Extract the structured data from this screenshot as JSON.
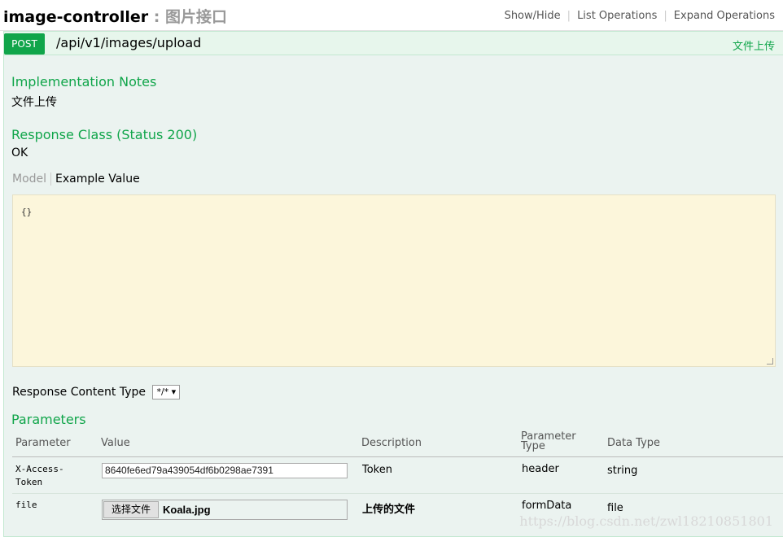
{
  "header": {
    "controller": "image-controller",
    "separator": " : ",
    "description": "图片接口",
    "ops": [
      "Show/Hide",
      "List Operations",
      "Expand Operations"
    ]
  },
  "operation": {
    "method": "POST",
    "path": "/api/v1/images/upload",
    "summary": "文件上传"
  },
  "implementation": {
    "heading": "Implementation Notes",
    "text": "文件上传"
  },
  "response": {
    "heading": "Response Class (Status 200)",
    "text": "OK",
    "tabs": {
      "model": "Model",
      "example": "Example Value"
    },
    "example": "{}"
  },
  "response_content_type": {
    "label": "Response Content Type",
    "selected": "*/*"
  },
  "parameters": {
    "heading": "Parameters",
    "columns": {
      "parameter": "Parameter",
      "value": "Value",
      "description": "Description",
      "type_line1": "Parameter",
      "type_line2": "Type",
      "data_type": "Data Type"
    },
    "rows": [
      {
        "name_line1": "X-Access-",
        "name_line2": "Token",
        "value": "8640fe6ed79a439054df6b0298ae7391",
        "description": "Token",
        "param_type": "header",
        "data_type": "string"
      },
      {
        "name_line1": "file",
        "file_button": "选择文件",
        "file_name": "Koala.jpg",
        "description": "上传的文件",
        "param_type": "formData",
        "data_type": "file"
      }
    ]
  },
  "watermark": "https://blog.csdn.net/zwl18210851801",
  "colors": {
    "accent": "#10a54a",
    "panel": "#ebf3f0",
    "example_bg": "#fcf6db"
  }
}
